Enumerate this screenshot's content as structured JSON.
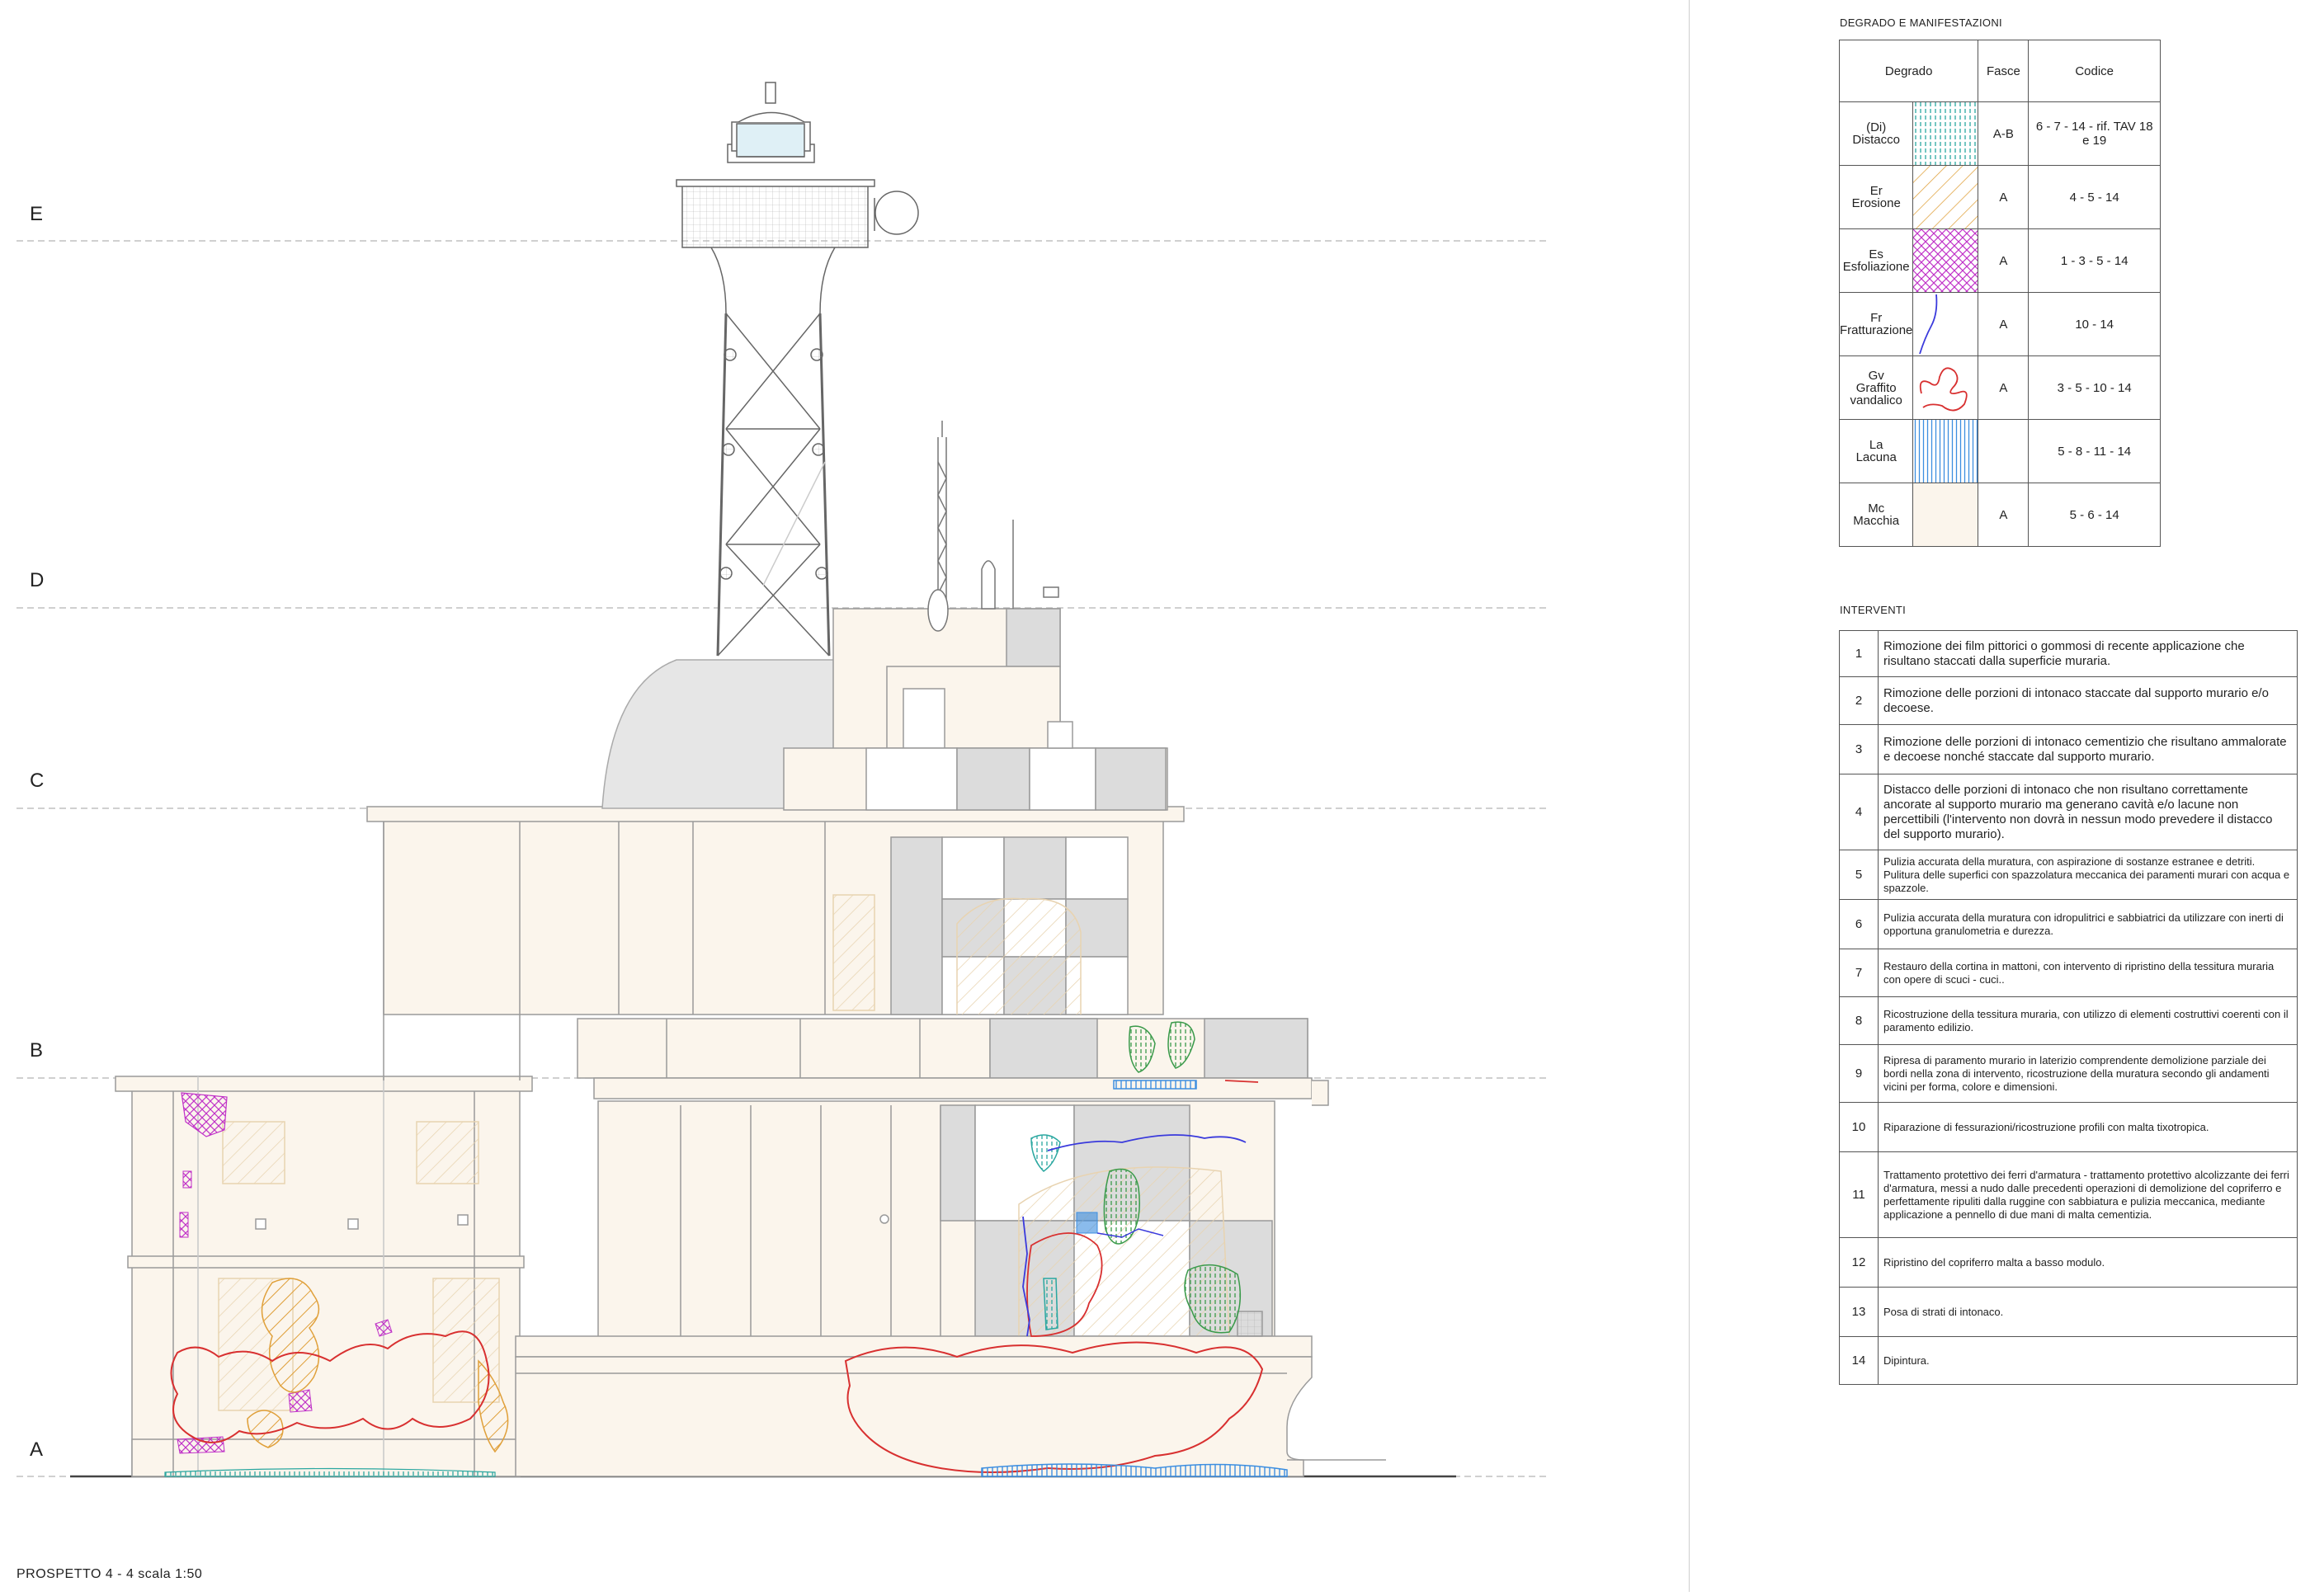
{
  "elevation": {
    "bands": [
      "E",
      "D",
      "C",
      "B",
      "A"
    ],
    "caption": "PROSPETTO 4 - 4 scala 1:50"
  },
  "legend": {
    "title": "DEGRADO E MANIFESTAZIONI",
    "headers": {
      "degrado": "Degrado",
      "fasce": "Fasce",
      "codice": "Codice"
    },
    "rows": [
      {
        "abbr": "(Di)",
        "name": "Distacco",
        "fasce": "A-B",
        "codice": "6 - 7 - 14 - rif. TAV 18 e 19",
        "pattern": "vertical-dots",
        "color": "#2aa7a0"
      },
      {
        "abbr": "Er",
        "name": "Erosione",
        "fasce": "A",
        "codice": "4 - 5 - 14",
        "pattern": "diagonal-hatch",
        "color": "#e0a03a"
      },
      {
        "abbr": "Es",
        "name": "Esfoliazione",
        "fasce": "A",
        "codice": "1 - 3 - 5 - 14",
        "pattern": "crosshatch",
        "color": "#c032c8"
      },
      {
        "abbr": "Fr",
        "name": "Fratturazione",
        "fasce": "A",
        "codice": "10 - 14",
        "pattern": "line",
        "color": "#3a3adc"
      },
      {
        "abbr": "Gv",
        "name": "Graffito",
        "name2": "vandalico",
        "fasce": "A",
        "codice": "3 - 5 - 10 - 14",
        "pattern": "outline",
        "color": "#d83030"
      },
      {
        "abbr": "La",
        "name": "Lacuna",
        "fasce": "",
        "codice": "5 - 8 - 11 - 14",
        "pattern": "vertical-lines",
        "color": "#3c8ee0"
      },
      {
        "abbr": "Mc",
        "name": "Macchia",
        "fasce": "A",
        "codice": "5 - 6 - 14",
        "pattern": "flat",
        "color": "#fbf5ec"
      }
    ]
  },
  "interventions": {
    "title": "INTERVENTI",
    "items": [
      {
        "n": "1",
        "text": "Rimozione dei film pittorici o gommosi di recente applicazione che risultano staccati dalla superficie muraria."
      },
      {
        "n": "2",
        "text": "Rimozione delle porzioni di intonaco staccate dal supporto murario e/o decoese."
      },
      {
        "n": "3",
        "text": "Rimozione delle porzioni di intonaco cementizio che risultano ammalorate e decoese nonché staccate dal supporto murario."
      },
      {
        "n": "4",
        "text": "Distacco delle porzioni di intonaco che non risultano correttamente ancorate al supporto murario ma generano cavità e/o lacune non percettibili (l'intervento non dovrà in nessun modo prevedere il distacco del supporto murario)."
      },
      {
        "n": "5",
        "text": "Pulizia accurata della muratura, con aspirazione di sostanze estranee e detriti. Pulitura delle superfici con spazzolatura meccanica dei paramenti murari con acqua e spazzole."
      },
      {
        "n": "6",
        "text": "Pulizia accurata della muratura con idropulitrici e sabbiatrici da utilizzare con inerti di opportuna granulometria e durezza."
      },
      {
        "n": "7",
        "text": "Restauro della cortina in mattoni, con intervento di ripristino della tessitura muraria con opere di scuci - cuci.."
      },
      {
        "n": "8",
        "text": "Ricostruzione della tessitura muraria, con utilizzo di elementi costruttivi coerenti con il paramento edilizio."
      },
      {
        "n": "9",
        "text": "Ripresa di paramento murario in laterizio comprendente demolizione parziale dei bordi nella zona di intervento, ricostruzione della muratura secondo gli andamenti vicini per forma, colore e dimensioni."
      },
      {
        "n": "10",
        "text": "Riparazione di fessurazioni/ricostruzione profili con malta tixotropica."
      },
      {
        "n": "11",
        "text": "Trattamento protettivo dei ferri d'armatura - trattamento protettivo alcolizzante dei ferri d'armatura, messi a nudo dalle precedenti operazioni di demolizione del copriferro e perfettamente ripuliti dalla ruggine con sabbiatura e pulizia meccanica, mediante applicazione a pennello di due mani di malta cementizia."
      },
      {
        "n": "12",
        "text": "Ripristino del copriferro malta a basso modulo."
      },
      {
        "n": "13",
        "text": "Posa di strati di intonaco."
      },
      {
        "n": "14",
        "text": "Dipintura."
      }
    ]
  },
  "colors": {
    "wall": "#fbf5ec",
    "line": "#9a9a9a",
    "grey_panel": "#dcdcdc",
    "graffito": "#d83030",
    "distacco": "#2aa7a0",
    "erosione": "#e0a03a",
    "esfoliazione": "#c032c8",
    "fratturazione": "#3a3adc",
    "lacuna": "#3c8ee0"
  }
}
